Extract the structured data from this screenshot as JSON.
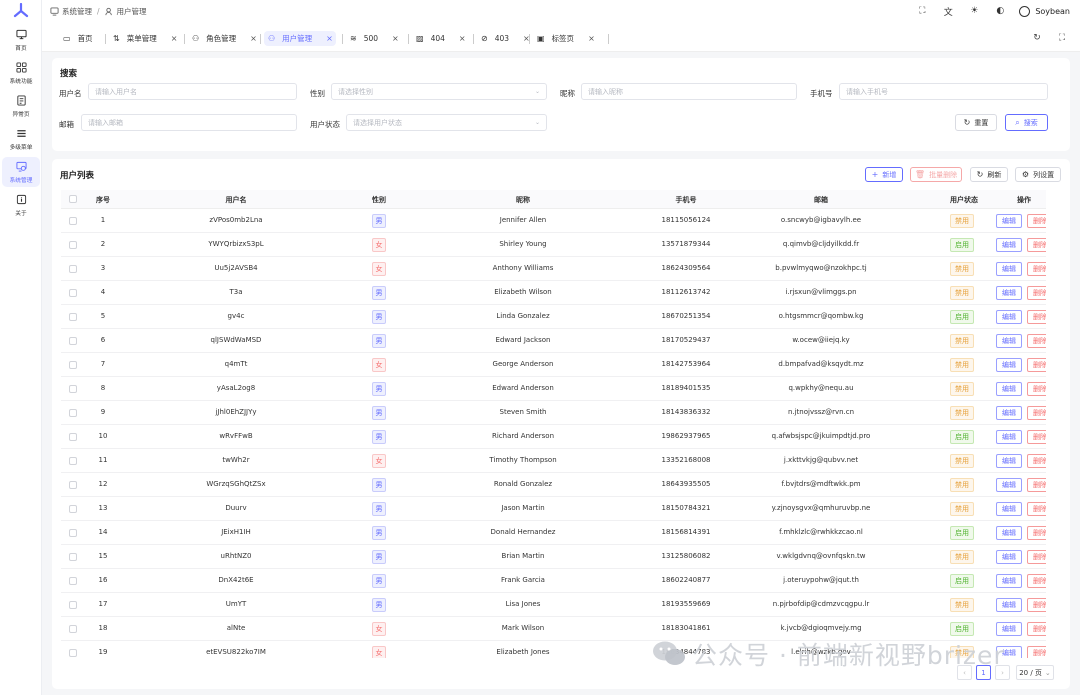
{
  "sidebar": {
    "logo": "soybean-logo",
    "items": [
      {
        "label": "首页",
        "icon": "monitor-icon"
      },
      {
        "label": "系统功能",
        "icon": "grid-icon"
      },
      {
        "label": "异常页",
        "icon": "document-warning-icon"
      },
      {
        "label": "多级菜单",
        "icon": "menu-icon"
      },
      {
        "label": "系统管理",
        "icon": "system-icon",
        "active": true
      },
      {
        "label": "关于",
        "icon": "info-icon"
      }
    ]
  },
  "header": {
    "breadcrumb": [
      "系统管理",
      "用户管理"
    ],
    "separator": "/",
    "user_name": "Soybean"
  },
  "tabs": [
    {
      "label": "首页",
      "icon": "monitor-icon",
      "closable": false
    },
    {
      "label": "菜单管理",
      "icon": "menu-tree-icon",
      "closable": true
    },
    {
      "label": "角色管理",
      "icon": "user-role-icon",
      "closable": true
    },
    {
      "label": "用户管理",
      "icon": "user-group-icon",
      "closable": true,
      "active": true
    },
    {
      "label": "500",
      "icon": "wifi-off-icon",
      "closable": true
    },
    {
      "label": "404",
      "icon": "image-off-icon",
      "closable": true
    },
    {
      "label": "403",
      "icon": "block-icon",
      "closable": true
    },
    {
      "label": "标签页",
      "icon": "tab-icon",
      "closable": true
    }
  ],
  "search": {
    "title": "搜索",
    "username_label": "用户名",
    "username_placeholder": "请输入用户名",
    "gender_label": "性别",
    "gender_placeholder": "请选择性别",
    "nickname_label": "昵称",
    "nickname_placeholder": "请输入昵称",
    "phone_label": "手机号",
    "phone_placeholder": "请输入手机号",
    "email_label": "邮箱",
    "email_placeholder": "请输入邮箱",
    "status_label": "用户状态",
    "status_placeholder": "请选择用户状态",
    "reset_label": "重置",
    "search_label": "搜索"
  },
  "list": {
    "title": "用户列表",
    "add_label": "新增",
    "batch_delete_label": "批量删除",
    "refresh_label": "刷新",
    "columns_label": "列设置",
    "columns": [
      "序号",
      "用户名",
      "性别",
      "昵称",
      "手机号",
      "邮箱",
      "用户状态",
      "操作"
    ],
    "edit_label": "编辑",
    "delete_label": "删除",
    "rows": [
      {
        "index": "1",
        "username": "zVPos0mb2Lna",
        "gender": "男",
        "nickname": "Jennifer Allen",
        "phone": "18115056124",
        "email": "o.sncwyb@igbavylh.ee",
        "status": "禁用"
      },
      {
        "index": "2",
        "username": "YWYQrbizxS3pL",
        "gender": "女",
        "nickname": "Shirley Young",
        "phone": "13571879344",
        "email": "q.qimvb@cljdyilkdd.fr",
        "status": "启用"
      },
      {
        "index": "3",
        "username": "Uu5j2AVSB4",
        "gender": "女",
        "nickname": "Anthony Williams",
        "phone": "18624309564",
        "email": "b.pvwlmyqwo@nzokhpc.tj",
        "status": "禁用"
      },
      {
        "index": "4",
        "username": "T3a",
        "gender": "男",
        "nickname": "Elizabeth Wilson",
        "phone": "18112613742",
        "email": "i.rjsxun@vlimggs.pn",
        "status": "禁用"
      },
      {
        "index": "5",
        "username": "gv4c",
        "gender": "男",
        "nickname": "Linda Gonzalez",
        "phone": "18670251354",
        "email": "o.htgsmmcr@qombw.kg",
        "status": "启用"
      },
      {
        "index": "6",
        "username": "qlJSWdWaMSD",
        "gender": "男",
        "nickname": "Edward Jackson",
        "phone": "18170529437",
        "email": "w.ocew@iiejq.ky",
        "status": "禁用"
      },
      {
        "index": "7",
        "username": "q4mTt",
        "gender": "女",
        "nickname": "George Anderson",
        "phone": "18142753964",
        "email": "d.bmpafvad@ksqydt.mz",
        "status": "禁用"
      },
      {
        "index": "8",
        "username": "yAsaL2og8",
        "gender": "男",
        "nickname": "Edward Anderson",
        "phone": "18189401535",
        "email": "q.wpkhy@nequ.au",
        "status": "禁用"
      },
      {
        "index": "9",
        "username": "jJhl0EhZJJYy",
        "gender": "男",
        "nickname": "Steven Smith",
        "phone": "18143836332",
        "email": "n.jtnojvssz@rvn.cn",
        "status": "禁用"
      },
      {
        "index": "10",
        "username": "wRvFFwB",
        "gender": "男",
        "nickname": "Richard Anderson",
        "phone": "19862937965",
        "email": "q.afwbsjspc@jkuimpdtjd.pro",
        "status": "启用"
      },
      {
        "index": "11",
        "username": "twWh2r",
        "gender": "女",
        "nickname": "Timothy Thompson",
        "phone": "13352168008",
        "email": "j.xkttvkjg@qubvv.net",
        "status": "禁用"
      },
      {
        "index": "12",
        "username": "WGrzqSGhQtZSx",
        "gender": "男",
        "nickname": "Ronald Gonzalez",
        "phone": "18643935505",
        "email": "f.bvjtdrs@mdftwkk.pm",
        "status": "禁用"
      },
      {
        "index": "13",
        "username": "Duurv",
        "gender": "男",
        "nickname": "Jason Martin",
        "phone": "18150784321",
        "email": "y.zjnoysgvx@qmhuruvbp.ne",
        "status": "禁用"
      },
      {
        "index": "14",
        "username": "JEixH1IH",
        "gender": "男",
        "nickname": "Donald Hernandez",
        "phone": "18156814391",
        "email": "f.mhklzlc@rwhkkzcao.nl",
        "status": "启用"
      },
      {
        "index": "15",
        "username": "uRhtNZ0",
        "gender": "男",
        "nickname": "Brian Martin",
        "phone": "13125806082",
        "email": "v.wklgdvnq@ovnfqskn.tw",
        "status": "禁用"
      },
      {
        "index": "16",
        "username": "DnX42t6E",
        "gender": "男",
        "nickname": "Frank Garcia",
        "phone": "18602240877",
        "email": "j.oteruypohw@jqut.th",
        "status": "启用"
      },
      {
        "index": "17",
        "username": "UmYT",
        "gender": "男",
        "nickname": "Lisa Jones",
        "phone": "18193559669",
        "email": "n.pjrbofdip@cdmzvcqgpu.lr",
        "status": "禁用"
      },
      {
        "index": "18",
        "username": "alNte",
        "gender": "女",
        "nickname": "Mark Wilson",
        "phone": "18183041861",
        "email": "k.jvcb@dgioqmvejy.mg",
        "status": "启用"
      },
      {
        "index": "19",
        "username": "etEVSU822ko7IM",
        "gender": "女",
        "nickname": "Elizabeth Jones",
        "phone": "18634844783",
        "email": "l.elrih@wzkb.gov",
        "status": "禁用"
      }
    ]
  },
  "pagination": {
    "current_page": "1",
    "page_size": "20 / 页"
  },
  "watermark": {
    "text": "公众号 · 前端新视野brizer",
    "icon": "wechat-icon"
  },
  "colors": {
    "primary": "#646cff",
    "danger": "#f56c6c",
    "warning": "#e6a23c",
    "success": "#52b430"
  }
}
